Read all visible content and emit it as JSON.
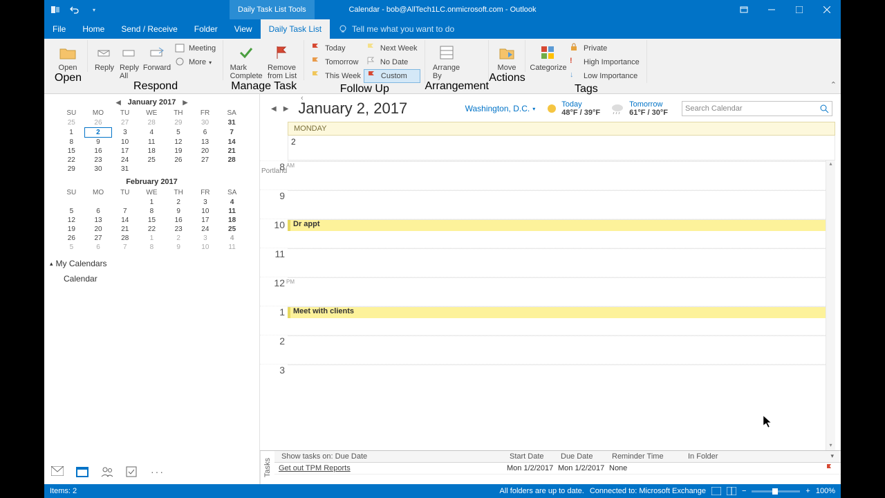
{
  "titlebar": {
    "context_tab": "Daily Task List Tools",
    "title": "Calendar - bob@AllTech1LC.onmicrosoft.com - Outlook"
  },
  "tabs": [
    "File",
    "Home",
    "Send / Receive",
    "Folder",
    "View",
    "Daily Task List"
  ],
  "tellme": "Tell me what you want to do",
  "ribbon": {
    "open": {
      "open": "Open",
      "group": "Open"
    },
    "respond": {
      "reply": "Reply",
      "reply_all": "Reply\nAll",
      "forward": "Forward",
      "meeting": "Meeting",
      "more": "More",
      "group": "Respond"
    },
    "manage": {
      "mark": "Mark\nComplete",
      "remove": "Remove\nfrom List",
      "group": "Manage Task"
    },
    "followup": {
      "today": "Today",
      "tomorrow": "Tomorrow",
      "thisweek": "This Week",
      "nextweek": "Next Week",
      "nodate": "No Date",
      "custom": "Custom",
      "group": "Follow Up"
    },
    "arrange": {
      "arrange": "Arrange\nBy",
      "group": "Arrangement"
    },
    "actions": {
      "move": "Move",
      "group": "Actions"
    },
    "categorize": {
      "cat": "Categorize"
    },
    "tags": {
      "private": "Private",
      "high": "High Importance",
      "low": "Low Importance",
      "group": "Tags"
    }
  },
  "minical": {
    "months": [
      "January 2017",
      "February 2017"
    ],
    "dow": [
      "SU",
      "MO",
      "TU",
      "WE",
      "TH",
      "FR",
      "SA"
    ]
  },
  "mycals": {
    "header": "My Calendars",
    "items": [
      "Calendar"
    ]
  },
  "calview": {
    "date_title": "January 2, 2017",
    "location": "Washington,  D.C.",
    "weather": {
      "today": {
        "label": "Today",
        "temp": "48°F / 39°F"
      },
      "tomorrow": {
        "label": "Tomorrow",
        "temp": "61°F / 30°F"
      }
    },
    "search_placeholder": "Search Calendar",
    "day_name": "MONDAY",
    "day_num": "2",
    "tz": "Portland",
    "appointments": [
      {
        "time": "10",
        "title": "Dr appt"
      },
      {
        "time": "1",
        "title": "Meet with clients"
      }
    ]
  },
  "tasks": {
    "header": "Show tasks on: Due Date",
    "cols": {
      "subject": "",
      "start": "Start Date",
      "due": "Due Date",
      "reminder": "Reminder Time",
      "folder": "In Folder"
    },
    "rows": [
      {
        "subject": "Get out TPM Reports",
        "start": "Mon 1/2/2017",
        "due": "Mon 1/2/2017",
        "reminder": "None",
        "folder": ""
      }
    ],
    "label": "Tasks"
  },
  "statusbar": {
    "items": "Items: 2",
    "sync": "All folders are up to date.",
    "conn": "Connected to: Microsoft Exchange",
    "zoom": "100%"
  }
}
